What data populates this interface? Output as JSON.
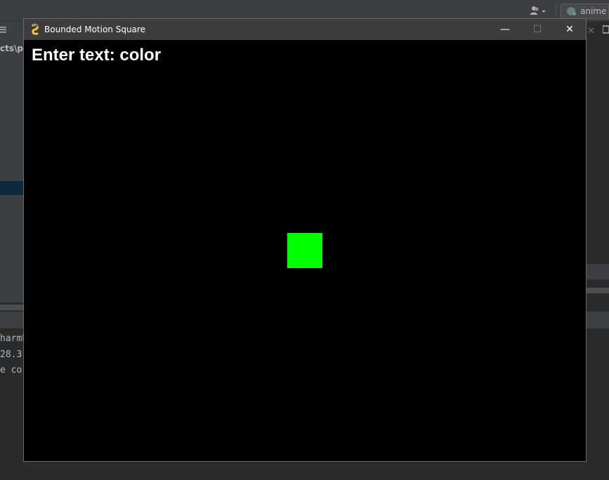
{
  "ide": {
    "user_menu_icon": "user-dropdown-icon",
    "vcs_label": "anime",
    "left_path": "cts\\pyt",
    "console_lines": [
      "harmP",
      "28.3",
      "e co"
    ]
  },
  "pygame_window": {
    "title": "Bounded Motion Square",
    "icon": "pygame-snake-icon",
    "min_glyph": "—",
    "max_glyph": "☐",
    "close_glyph": "✕",
    "prompt_text": "Enter text: color",
    "square_color": "#00ff00",
    "background_color": "#000000"
  }
}
